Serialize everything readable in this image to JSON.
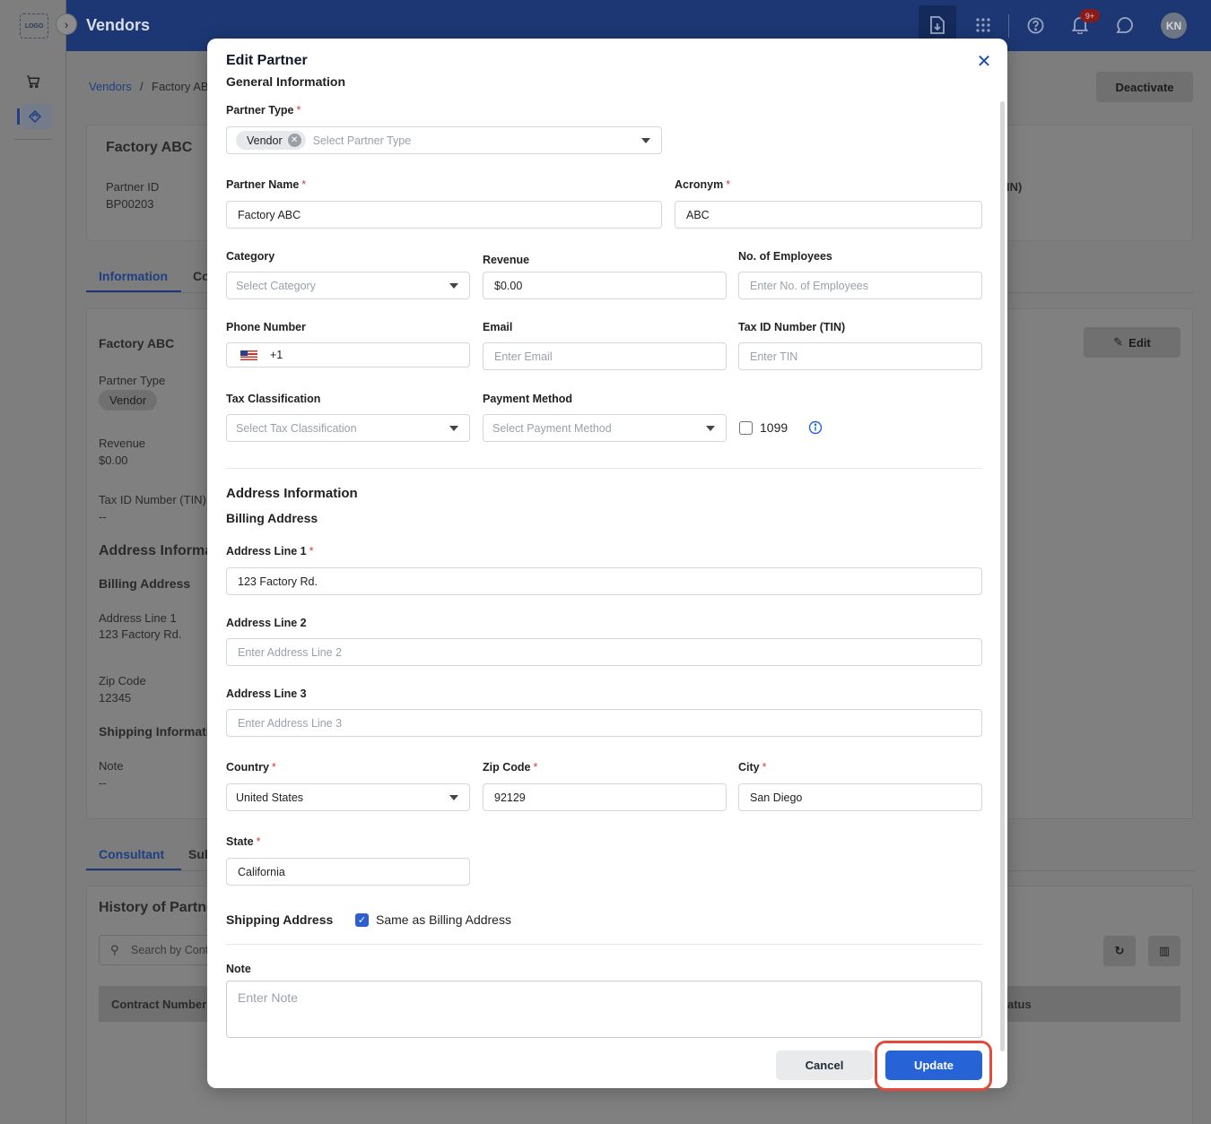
{
  "app": {
    "logo_text": "LOGO",
    "page_title": "Vendors",
    "notification_count": "9+",
    "user_initials": "KN"
  },
  "background": {
    "breadcrumb_root": "Vendors",
    "breadcrumb_sep": "/",
    "breadcrumb_current": "Factory AB",
    "deactivate_label": "Deactivate",
    "header_name": "Factory ABC",
    "partner_id_label": "Partner ID",
    "partner_id_value": "BP00203",
    "tin_fragment": "IN)",
    "tab_information": "Information",
    "tab_co": "Co",
    "info_title": "Factory ABC",
    "edit_label": "Edit",
    "partner_type_label": "Partner Type",
    "partner_type_value": "Vendor",
    "revenue_label": "Revenue",
    "revenue_value": "$0.00",
    "tin_label": "Tax ID Number (TIN)",
    "tin_value": "--",
    "address_info_label": "Address Informa",
    "billing_address_label": "Billing Address",
    "address_line1_label": "Address Line 1",
    "address_line1_value": "123 Factory Rd.",
    "zip_label": "Zip Code",
    "zip_value": "12345",
    "shipping_info_label": "Shipping Informati",
    "note_label": "Note",
    "note_value": "--",
    "tab_consultant": "Consultant",
    "tab_sub": "Sub",
    "history_label": "History of Partne",
    "search_placeholder": "Search by Cont",
    "col_contract_number": "Contract Number",
    "col_status_fragment": "atus"
  },
  "modal": {
    "title": "Edit Partner",
    "general_info": "General Information",
    "partner_type_label": "Partner Type",
    "partner_type_chip": "Vendor",
    "partner_type_placeholder": "Select Partner Type",
    "partner_name_label": "Partner Name",
    "partner_name_value": "Factory ABC",
    "acronym_label": "Acronym",
    "acronym_value": "ABC",
    "category_label": "Category",
    "category_placeholder": "Select Category",
    "revenue_label": "Revenue",
    "revenue_value": "$0.00",
    "employees_label": "No. of Employees",
    "employees_placeholder": "Enter No. of Employees",
    "phone_label": "Phone Number",
    "phone_code": "+1",
    "email_label": "Email",
    "email_placeholder": "Enter Email",
    "tin_label": "Tax ID Number (TIN)",
    "tin_placeholder": "Enter TIN",
    "tax_class_label": "Tax Classification",
    "tax_class_placeholder": "Select Tax Classification",
    "payment_label": "Payment Method",
    "payment_placeholder": "Select Payment Method",
    "form1099_label": "1099",
    "address_info": "Address Information",
    "billing_address": "Billing Address",
    "addr1_label": "Address Line 1",
    "addr1_value": "123 Factory Rd.",
    "addr2_label": "Address Line 2",
    "addr2_placeholder": "Enter Address Line 2",
    "addr3_label": "Address Line 3",
    "addr3_placeholder": "Enter Address Line 3",
    "country_label": "Country",
    "country_value": "United States",
    "zip_label": "Zip Code",
    "zip_value": "92129",
    "city_label": "City",
    "city_value": "San Diego",
    "state_label": "State",
    "state_value": "California",
    "shipping_address": "Shipping Address",
    "same_as_billing": "Same as Billing Address",
    "note_label": "Note",
    "note_placeholder": "Enter Note",
    "cancel_label": "Cancel",
    "update_label": "Update",
    "required_mark": "*"
  },
  "colors": {
    "primary": "#2563d6",
    "topbar": "#1c3773",
    "required": "#d63a3a",
    "highlight": "#e24a3a"
  }
}
